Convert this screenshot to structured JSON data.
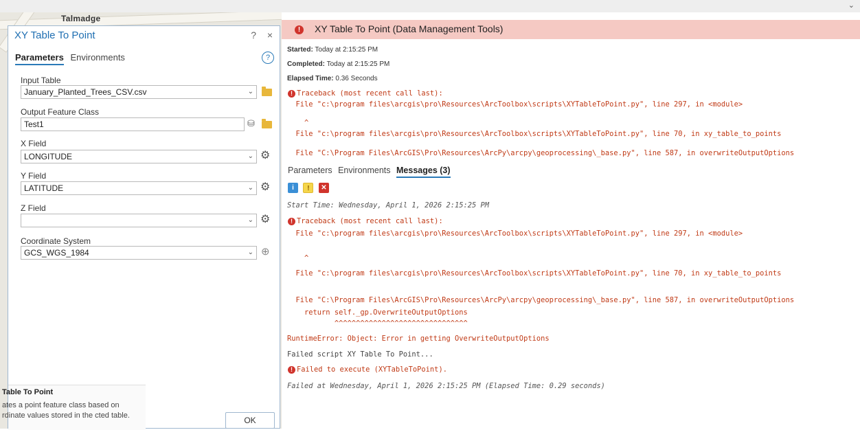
{
  "map": {
    "street_label": "Talmadge"
  },
  "tool": {
    "title": "XY Table To Point",
    "help_symbol": "?",
    "close_symbol": "×",
    "tabs": [
      {
        "label": "Parameters"
      },
      {
        "label": "Environments"
      }
    ],
    "params": {
      "input_table": {
        "label": "Input Table",
        "value": "January_Planted_Trees_CSV.csv"
      },
      "output_fc": {
        "label": "Output Feature Class",
        "value": "Test1"
      },
      "x_field": {
        "label": "X Field",
        "value": "LONGITUDE"
      },
      "y_field": {
        "label": "Y Field",
        "value": "LATITUDE"
      },
      "z_field": {
        "label": "Z Field",
        "value": ""
      },
      "coord_sys": {
        "label": "Coordinate System",
        "value": "GCS_WGS_1984"
      }
    },
    "tooltip": {
      "title": "Table To Point",
      "text": "ates a point feature class based on rdinate values stored in the cted table."
    },
    "ok_label": "OK"
  },
  "messages": {
    "header_title": "XY Table To Point (Data Management Tools)",
    "started_label": "Started:",
    "started_value": "Today at 2:15:25 PM",
    "completed_label": "Completed:",
    "completed_value": "Today at 2:15:25 PM",
    "elapsed_label": "Elapsed Time:",
    "elapsed_value": "0.36 Seconds",
    "summary_lines": [
      "Traceback (most recent call last):",
      "  File \"c:\\program files\\arcgis\\pro\\Resources\\ArcToolbox\\scripts\\XYTableToPoint.py\", line 297, in <module>",
      "    ^",
      "  File \"c:\\program files\\arcgis\\pro\\Resources\\ArcToolbox\\scripts\\XYTableToPoint.py\", line 70, in xy_table_to_points",
      "  File \"C:\\Program Files\\ArcGIS\\Pro\\Resources\\ArcPy\\arcpy\\geoprocessing\\_base.py\", line 587, in overwriteOutputOptions"
    ],
    "tabs": [
      {
        "label": "Parameters"
      },
      {
        "label": "Environments"
      },
      {
        "label": "Messages (3)"
      }
    ],
    "filters": {
      "info": "i",
      "warn": "!",
      "err": "✕"
    },
    "start_time": "Start Time: Wednesday, April 1, 2026 2:15:25 PM",
    "detail_lines": [
      "Traceback (most recent call last):",
      "  File \"c:\\program files\\arcgis\\pro\\Resources\\ArcToolbox\\scripts\\XYTableToPoint.py\", line 297, in <module>",
      "    ^",
      "  File \"c:\\program files\\arcgis\\pro\\Resources\\ArcToolbox\\scripts\\XYTableToPoint.py\", line 70, in xy_table_to_points",
      "  File \"C:\\Program Files\\ArcGIS\\Pro\\Resources\\ArcPy\\arcpy\\geoprocessing\\_base.py\", line 587, in overwriteOutputOptions",
      "    return self._gp.OverwriteOutputOptions",
      "           ^^^^^^^^^^^^^^^^^^^^^^^^^^^^^^^",
      "RuntimeError: Object: Error in getting OverwriteOutputOptions"
    ],
    "failed_script": "Failed script XY Table To Point...",
    "failed_execute": "Failed to execute (XYTableToPoint).",
    "failed_at": "Failed at Wednesday, April 1, 2026 2:15:25 PM (Elapsed Time: 0.29 seconds)"
  }
}
